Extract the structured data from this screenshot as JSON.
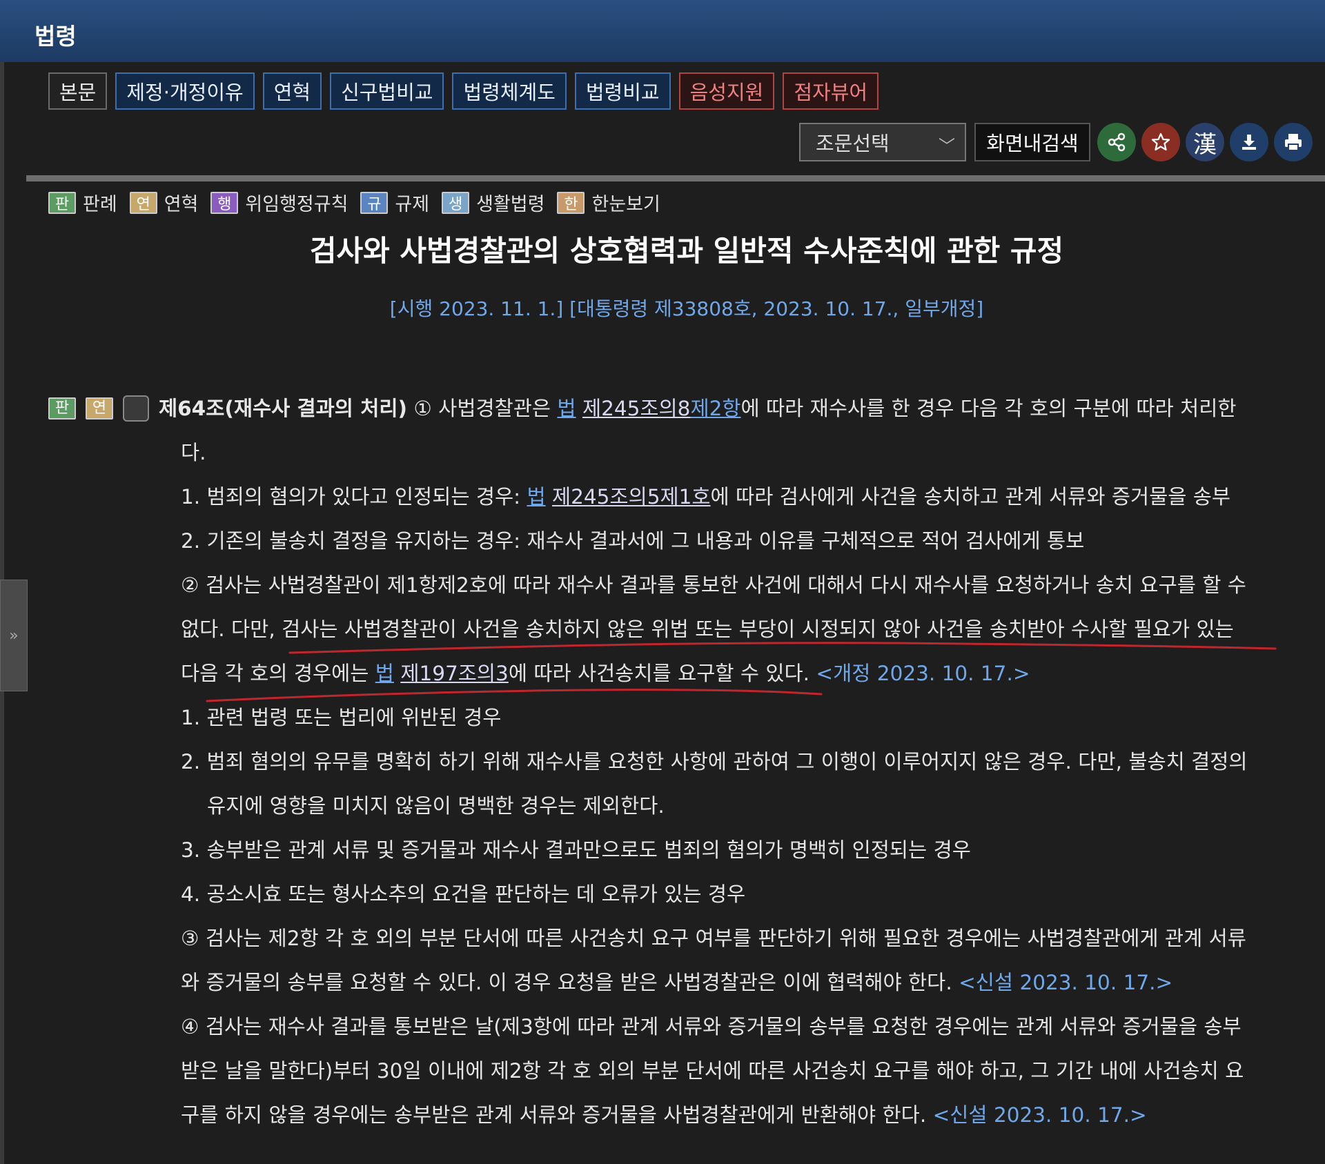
{
  "header": {
    "title": "법령"
  },
  "tabs": [
    {
      "label": "본문"
    },
    {
      "label": "제정·개정이유"
    },
    {
      "label": "연혁"
    },
    {
      "label": "신구법비교"
    },
    {
      "label": "법령체계도"
    },
    {
      "label": "법령비교"
    },
    {
      "label": "음성지원"
    },
    {
      "label": "점자뷰어"
    }
  ],
  "toolbar": {
    "select_value": "조문선택",
    "search_label": "화면내검색",
    "hanja_label": "漢",
    "icons": [
      "share-icon",
      "star-icon",
      "hanja-icon",
      "download-icon",
      "print-icon"
    ]
  },
  "legend": [
    {
      "badge": "판",
      "label": "판례"
    },
    {
      "badge": "연",
      "label": "연혁"
    },
    {
      "badge": "행",
      "label": "위임행정규칙"
    },
    {
      "badge": "규",
      "label": "규제"
    },
    {
      "badge": "생",
      "label": "생활법령"
    },
    {
      "badge": "한",
      "label": "한눈보기"
    }
  ],
  "document": {
    "title": "검사와 사법경찰관의 상호협력과 일반적 수사준칙에 관한 규정",
    "meta": "[시행 2023. 11. 1.] [대통령령 제33808호, 2023. 10. 17., 일부개정]"
  },
  "article": {
    "badges": [
      "판",
      "연"
    ],
    "heading": "제64조(재수사 결과의 처리)",
    "p1_start": "① 사법경찰관은 ",
    "p1_link_a": "법",
    "p1_link_b": "제245조의8",
    "p1_link_c": "제2항",
    "p1_end": "에 따라 재수사를 한 경우 다음 각 호의 구분에 따라 처리한",
    "p1_cont": "다.",
    "i1_start": "1. 범죄의 혐의가 있다고 인정되는 경우: ",
    "i1_link_a": "법",
    "i1_link_b": "제245조의5제1호",
    "i1_end": "에 따라 검사에게 사건을 송치하고 관계 서류와 증거물을 송부",
    "i2": "2. 기존의 불송치 결정을 유지하는 경우: 재수사 결과서에 그 내용과 이유를 구체적으로 적어 검사에게 통보",
    "p2_line1": "② 검사는 사법경찰관이 제1항제2호에 따라 재수사 결과를 통보한 사건에 대해서 다시 재수사를 요청하거나 송치 요구를 할 수",
    "p2_line2": "없다. 다만, 검사는 사법경찰관이 사건을 송치하지 않은 위법 또는 부당이 시정되지 않아 사건을 송치받아 수사할 필요가 있는",
    "p2_line3_start": "다음 각 호의 경우에는 ",
    "p2_link_a": "법",
    "p2_link_b": "제197조의3",
    "p2_line3_end": "에 따라 사건송치를 요구할 수 있다. ",
    "p2_note": "<개정 2023. 10. 17.>",
    "s1": "1. 관련 법령 또는 법리에 위반된 경우",
    "s2_line1": "2. 범죄 혐의의 유무를 명확히 하기 위해 재수사를 요청한 사항에 관하여 그 이행이 이루어지지 않은 경우. 다만, 불송치 결정의",
    "s2_line2": "유지에 영향을 미치지 않음이 명백한 경우는 제외한다.",
    "s3": "3. 송부받은 관계 서류 및 증거물과 재수사 결과만으로도 범죄의 혐의가 명백히 인정되는 경우",
    "s4": "4. 공소시효 또는 형사소추의 요건을 판단하는 데 오류가 있는 경우",
    "p3_line1": "③ 검사는 제2항 각 호 외의 부분 단서에 따른 사건송치 요구 여부를 판단하기 위해 필요한 경우에는 사법경찰관에게 관계 서류",
    "p3_line2": "와 증거물의 송부를 요청할 수 있다. 이 경우 요청을 받은 사법경찰관은 이에 협력해야 한다. ",
    "p3_note": "<신설 2023. 10. 17.>",
    "p4_line1": "④ 검사는 재수사 결과를 통보받은 날(제3항에 따라 관계 서류와 증거물의 송부를 요청한 경우에는 관계 서류와 증거물을 송부",
    "p4_line2": "받은 날을 말한다)부터 30일 이내에 제2항 각 호 외의 부분 단서에 따른 사건송치 요구를 해야 하고, 그 기간 내에 사건송치 요",
    "p4_line3": "구를 하지 않을 경우에는 송부받은 관계 서류와 증거물을 사법경찰관에게 반환해야 한다. ",
    "p4_note": "<신설 2023. 10. 17.>"
  },
  "colors": {
    "header_bg": "#1c3a63",
    "link": "#6fa8ea",
    "annotation_red": "#c0262d"
  }
}
